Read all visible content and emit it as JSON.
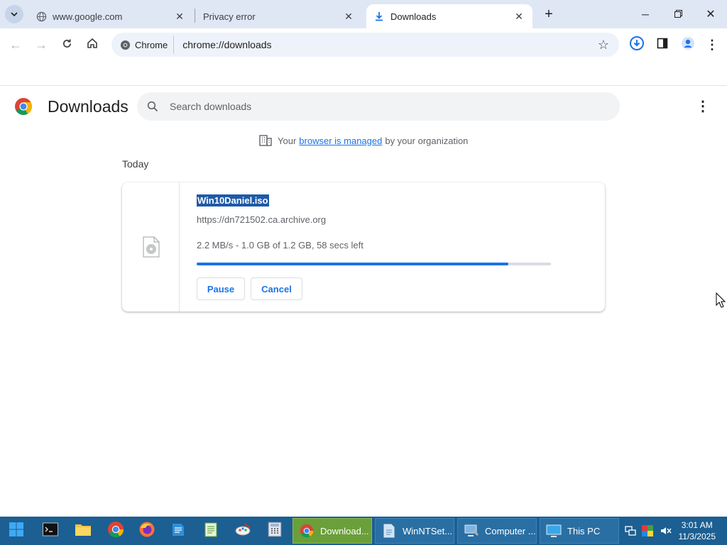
{
  "tabs": [
    {
      "title": "www.google.com",
      "icon": "globe-icon"
    },
    {
      "title": "Privacy error",
      "icon": "none"
    },
    {
      "title": "Downloads",
      "icon": "download-icon"
    }
  ],
  "toolbar": {
    "chip_label": "Chrome",
    "url": "chrome://downloads"
  },
  "page": {
    "title": "Downloads",
    "search_placeholder": "Search downloads",
    "managed_prefix": "Your",
    "managed_link": "browser is managed",
    "managed_suffix": "by your organization",
    "section_label": "Today"
  },
  "download": {
    "file_name": "Win10Daniel.iso",
    "source": "https://dn721502.ca.archive.org",
    "status": "2.2 MB/s - 1.0 GB of 1.2 GB, 58 secs left",
    "progress_percent": 88,
    "pause_label": "Pause",
    "cancel_label": "Cancel"
  },
  "taskbar": {
    "tasks": [
      {
        "label": "Download...",
        "icon": "chrome-icon",
        "active": true
      },
      {
        "label": "WinNTSet...",
        "icon": "document-icon",
        "active": false
      },
      {
        "label": "Computer ...",
        "icon": "computer-management-icon",
        "active": false
      },
      {
        "label": "This PC",
        "icon": "monitor-icon",
        "active": false
      }
    ],
    "time": "3:01 AM",
    "date": "11/3/2025"
  },
  "colors": {
    "accent": "#1a73e8",
    "tabstrip": "#dfe7f5",
    "taskbar": "#1c5f92",
    "active_task": "#6a9f3a"
  }
}
